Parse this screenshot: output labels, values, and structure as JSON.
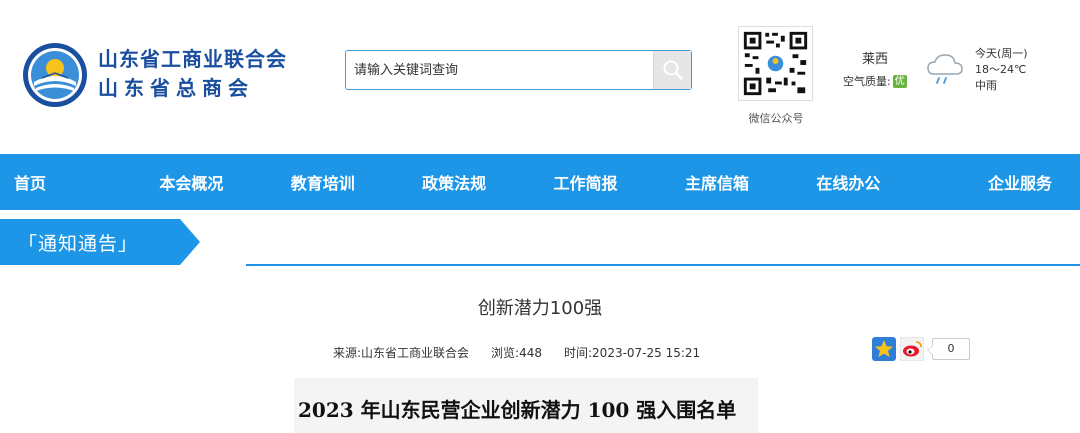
{
  "header": {
    "org_name_line1": "山东省工商业联合会",
    "org_name_line2": "山东省总商会",
    "search": {
      "placeholder": "请输入关键词查询"
    },
    "qr_label": "微信公众号",
    "weather": {
      "city": "莱西",
      "air_quality_label": "空气质量:",
      "air_quality_value": "优",
      "day": "今天(周一)",
      "temp": "18～24℃",
      "condition": "中雨"
    }
  },
  "nav": {
    "items": [
      {
        "label": "首页"
      },
      {
        "label": "本会概况"
      },
      {
        "label": "教育培训"
      },
      {
        "label": "政策法规"
      },
      {
        "label": "工作简报"
      },
      {
        "label": "主席信箱"
      },
      {
        "label": "在线办公"
      },
      {
        "label": "企业服务"
      }
    ]
  },
  "section": {
    "label": "「通知通告」"
  },
  "article": {
    "title": "创新潜力100强",
    "source": "来源:山东省工商业联合会",
    "views": "浏览:448",
    "time": "时间:2023-07-25 15:21",
    "share_count": "0",
    "doc_heading": "2023 年山东民营企业创新潜力 100 强入围名单"
  },
  "colors": {
    "brand_blue": "#1e96e8",
    "org_text": "#1a4fa0",
    "aq_green": "#6ab33f"
  }
}
